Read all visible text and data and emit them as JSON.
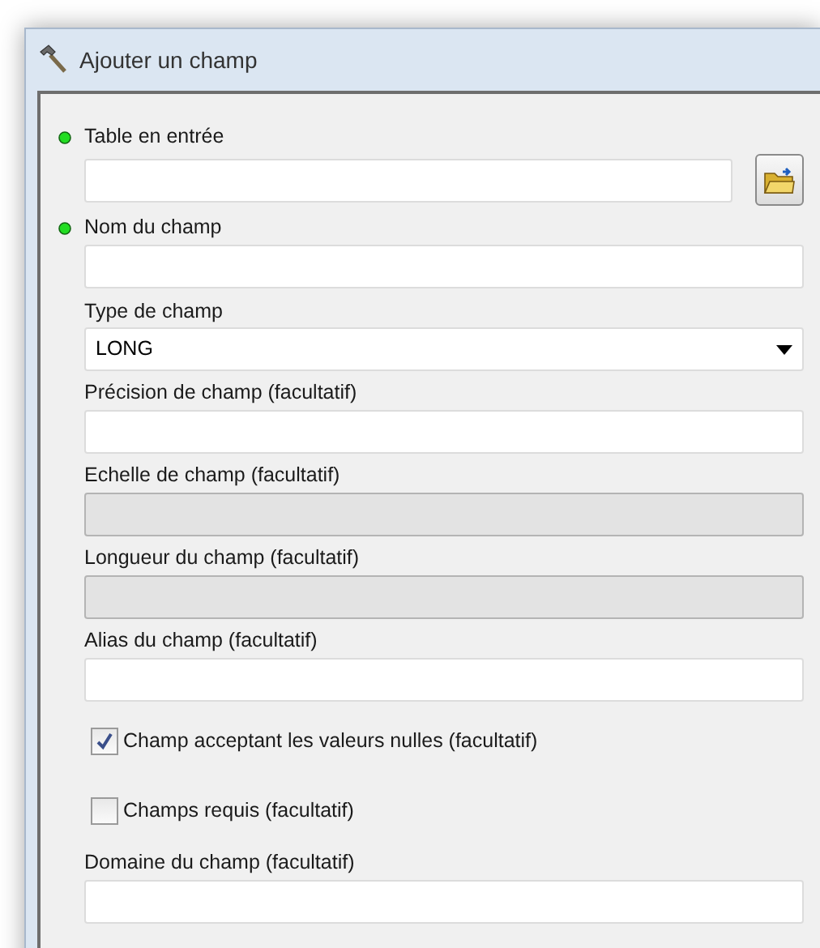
{
  "window": {
    "title": "Ajouter un champ"
  },
  "params": [
    {
      "kind": "field",
      "label": "Table en entrée",
      "required": true,
      "browse": true,
      "disabled": false
    },
    {
      "kind": "field",
      "label": "Nom du champ",
      "required": true,
      "browse": false,
      "disabled": false
    },
    {
      "kind": "dropdown",
      "label": "Type de champ",
      "value": "LONG"
    },
    {
      "kind": "field",
      "label": "Précision de champ (facultatif)",
      "required": false,
      "browse": false,
      "disabled": false
    },
    {
      "kind": "field",
      "label": "Echelle de champ (facultatif)",
      "required": false,
      "browse": false,
      "disabled": true
    },
    {
      "kind": "field",
      "label": "Longueur du champ (facultatif)",
      "required": false,
      "browse": false,
      "disabled": true
    },
    {
      "kind": "field",
      "label": "Alias du champ (facultatif)",
      "required": false,
      "browse": false,
      "disabled": false
    },
    {
      "kind": "checkbox",
      "label": "Champ acceptant les valeurs nulles (facultatif)",
      "checked": true
    },
    {
      "kind": "checkbox",
      "label": "Champs requis (facultatif)",
      "checked": false
    },
    {
      "kind": "field",
      "label": "Domaine du champ (facultatif)",
      "required": false,
      "browse": false,
      "disabled": false
    }
  ]
}
